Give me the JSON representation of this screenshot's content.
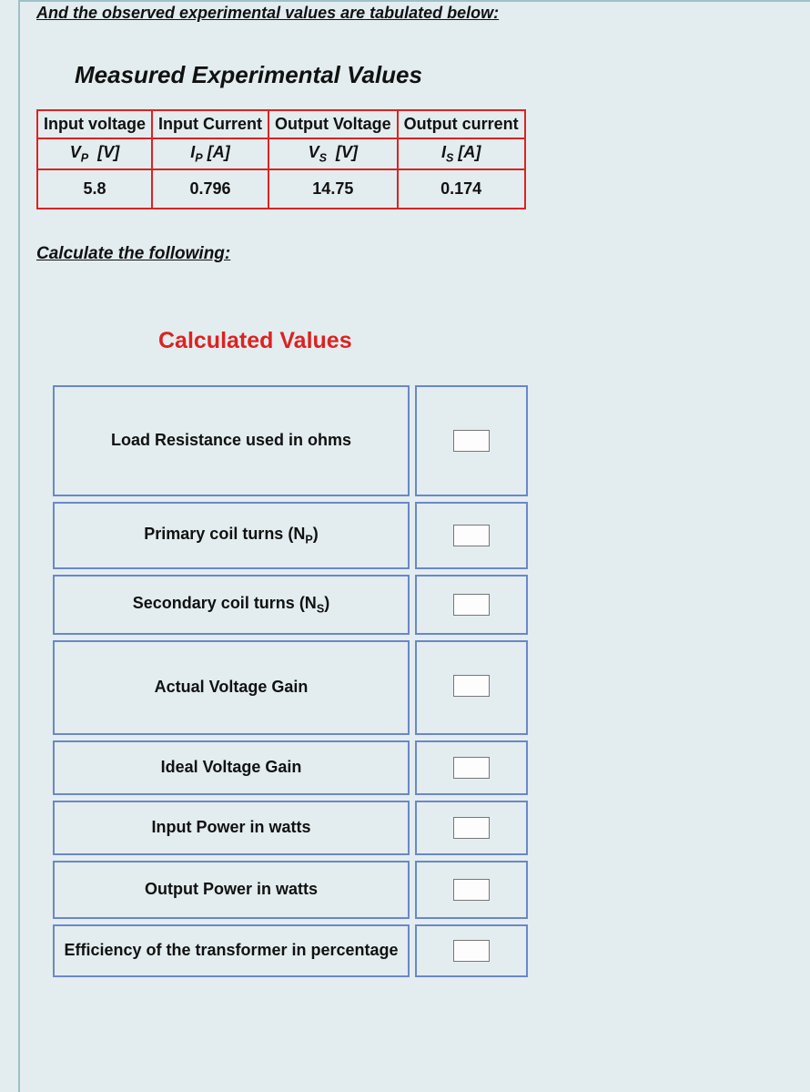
{
  "intro_text": "And the observed experimental values are tabulated below:",
  "measured_title": "Measured Experimental Values",
  "measured_table": {
    "headers": [
      "Input voltage",
      "Input Current",
      "Output Voltage",
      "Output current"
    ],
    "sub_headers": [
      "V_P  [V]",
      "I_P [A]",
      "V_S  [V]",
      "I_S [A]"
    ],
    "row": [
      "5.8",
      "0.796",
      "14.75",
      "0.174"
    ]
  },
  "calc_heading": "Calculate the following:",
  "calculated_title": "Calculated Values",
  "calc_rows": [
    "Load Resistance used in ohms",
    "Primary coil turns (N_P)",
    "Secondary coil turns (N_S)",
    "Actual Voltage Gain",
    "Ideal Voltage Gain",
    "Input Power in watts",
    "Output Power in watts",
    "Efficiency of the transformer in percentage"
  ],
  "chart_data": {
    "type": "table",
    "measured": {
      "Input voltage V_P [V]": 5.8,
      "Input Current I_P [A]": 0.796,
      "Output Voltage V_S [V]": 14.75,
      "Output current I_S [A]": 0.174
    }
  }
}
